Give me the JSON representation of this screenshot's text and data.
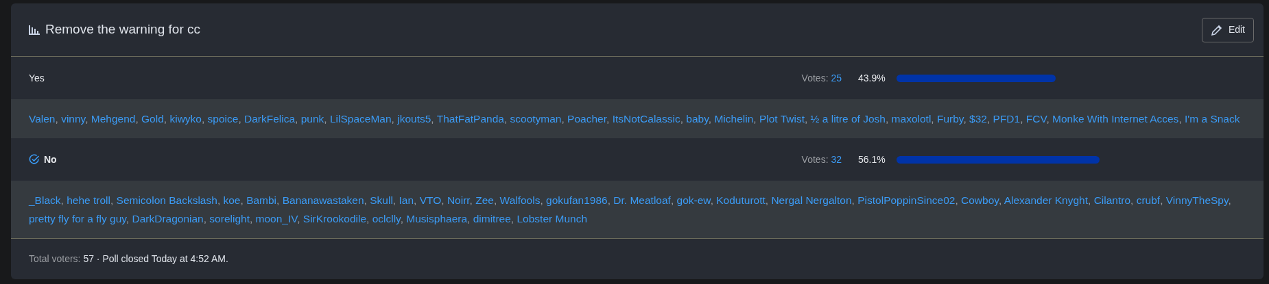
{
  "poll": {
    "title": "Remove the warning for cc",
    "edit_button": "Edit"
  },
  "voter_separator": ", ",
  "options": [
    {
      "label": "Yes",
      "voted": false,
      "votes_label": "Votes:",
      "votes": "25",
      "percent": "43.9%",
      "voters": [
        "Valen",
        "vinny",
        "Mehgend",
        "Gold",
        "kiwyko",
        "spoice",
        "DarkFelica",
        "punk",
        "LilSpaceMan",
        "jkouts5",
        "ThatFatPanda",
        "scootyman",
        "Poacher",
        "ItsNotCalassic",
        "baby",
        "Michelin",
        "Plot Twist",
        "½ a litre of Josh",
        "maxolotl",
        "Furby",
        "$32",
        "PFD1",
        "FCV",
        "Monke With Internet Acces",
        "I'm a Snack"
      ]
    },
    {
      "label": "No",
      "voted": true,
      "votes_label": "Votes:",
      "votes": "32",
      "percent": "56.1%",
      "voters": [
        "_Black",
        "hehe troll",
        "Semicolon Backslash",
        "koe",
        "Bambi",
        "Bananawastaken",
        "Skull",
        "Ian",
        "VTO",
        "Noirr",
        "Zee",
        "Walfools",
        "gokufan1986",
        "Dr. Meatloaf",
        "gok-ew",
        "Koduturott",
        "Nergal Nergalton",
        "PistolPoppinSince02",
        "Cowboy",
        "Alexander Knyght",
        "Cilantro",
        "crubf",
        "VinnyTheSpy",
        "pretty fly for a fly guy",
        "DarkDragonian",
        "sorelight",
        "moon_IV",
        "SirKrookodile",
        "oclclly",
        "Musisphaera",
        "dimitree",
        "Lobster Munch"
      ]
    }
  ],
  "footer": {
    "label": "Total voters:",
    "text": "57 · Poll closed Today at 4:52 AM."
  }
}
